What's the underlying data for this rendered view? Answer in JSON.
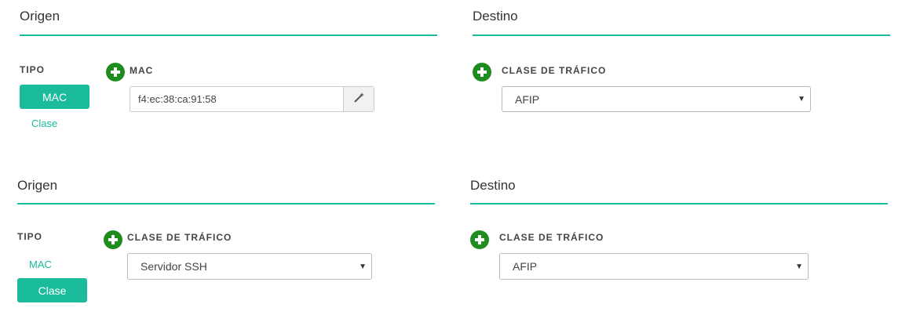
{
  "panel1": {
    "origen_title": "Origen",
    "destino_title": "Destino",
    "tipo_label": "TIPO",
    "tipo_options": [
      "MAC",
      "Clase"
    ],
    "tipo_selected": "MAC",
    "origen_field_label": "MAC",
    "mac_value": "f4:ec:38:ca:91:58",
    "destino_field_label": "CLASE DE TRÁFICO",
    "destino_value": "AFIP"
  },
  "panel2": {
    "origen_title": "Origen",
    "destino_title": "Destino",
    "tipo_label": "TIPO",
    "tipo_options": [
      "MAC",
      "Clase"
    ],
    "tipo_selected": "Clase",
    "origen_field_label": "CLASE DE TRÁFICO",
    "origen_value": "Servidor SSH",
    "destino_field_label": "CLASE DE TRÁFICO",
    "destino_value": "AFIP"
  },
  "colors": {
    "accent": "#1abc9c",
    "add_icon": "#1e8c1e"
  },
  "icons": {
    "add": "plus-circle-icon",
    "generate": "magic-wand-icon",
    "dropdown": "caret-down-icon"
  }
}
